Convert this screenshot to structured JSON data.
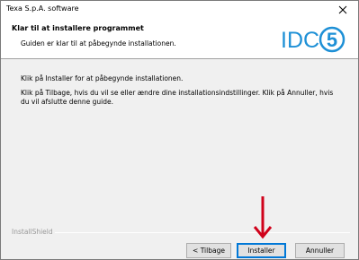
{
  "window": {
    "title": "Texa S.p.A. software",
    "close_symbol": "✕"
  },
  "header": {
    "title": "Klar til at installere programmet",
    "subtitle": "Guiden er klar til at påbegynde installationen.",
    "logo_text": "IDC",
    "logo_badge": "5",
    "logo_color": "#1e90d6"
  },
  "body": {
    "line1": "Klik på Installer for at påbegynde installationen.",
    "line2": "Klik på Tilbage, hvis du vil se eller ændre dine installationsindstillinger. Klik på Annuller, hvis du vil afslutte denne guide."
  },
  "footer": {
    "brand": "InstallShield",
    "back_label": "< Tilbage",
    "install_label": "Installer",
    "cancel_label": "Annuller"
  },
  "annotation": {
    "arrow_color": "#d0021b",
    "arrow_icon": "down-arrow-icon"
  }
}
